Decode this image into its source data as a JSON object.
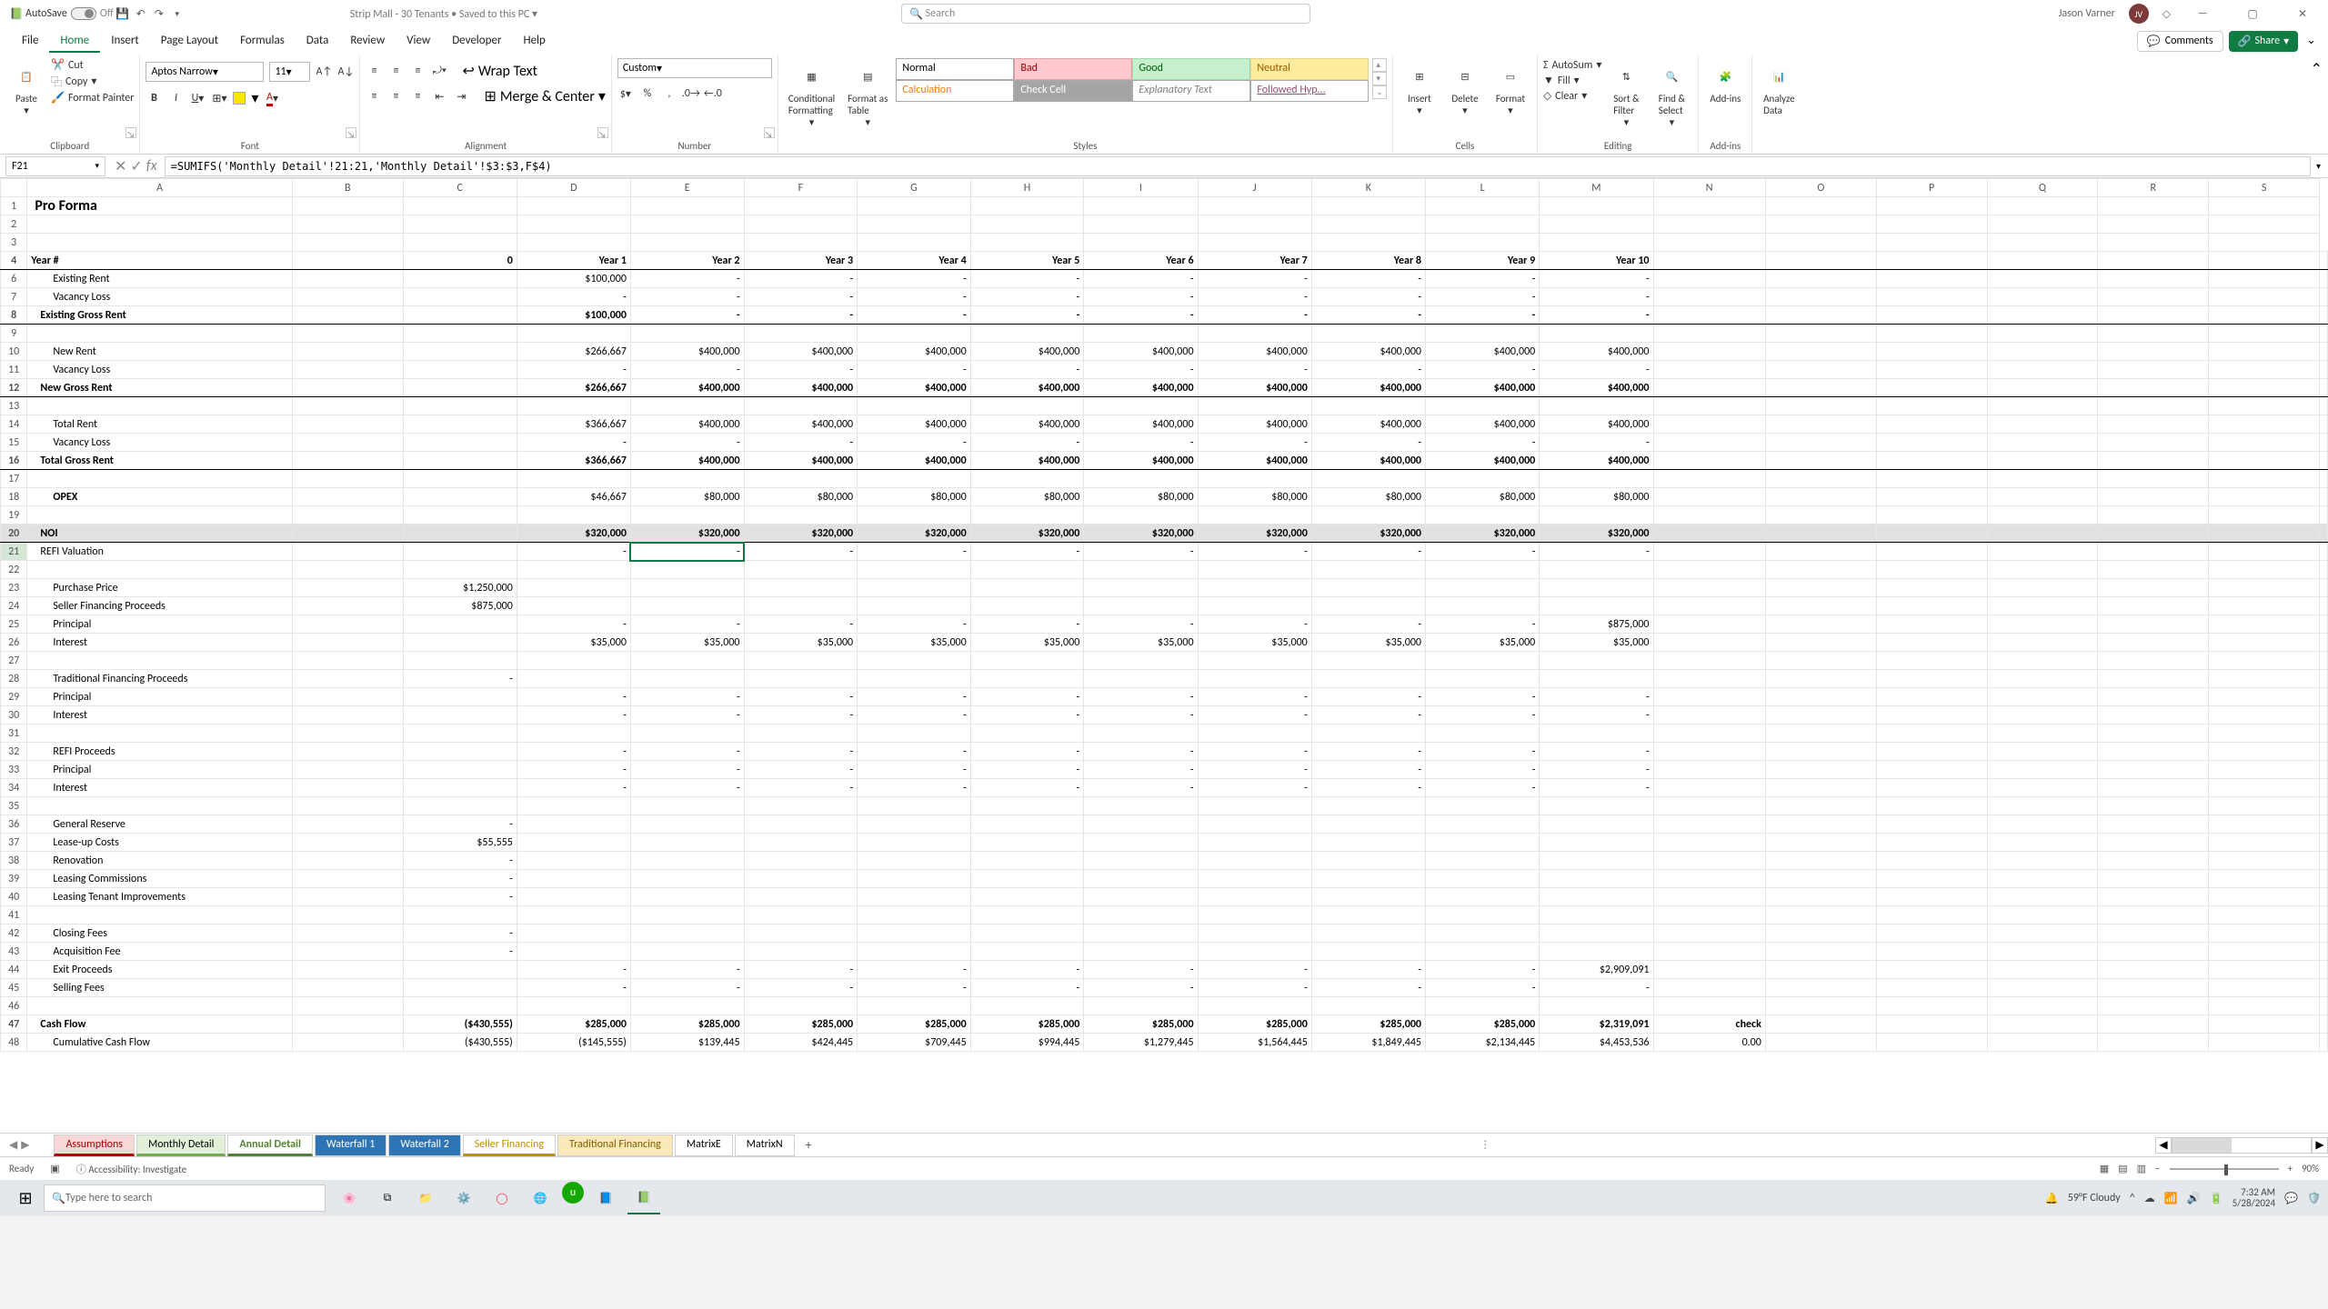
{
  "titleBar": {
    "autosave_label": "AutoSave",
    "autosave_state": "Off",
    "doc_name": "Strip Mall - 30 Tenants • Saved to this PC ▾",
    "search_placeholder": "Search",
    "user_name": "Jason Varner",
    "user_initials": "JV"
  },
  "menu": {
    "items": [
      "File",
      "Home",
      "Insert",
      "Page Layout",
      "Formulas",
      "Data",
      "Review",
      "View",
      "Developer",
      "Help"
    ],
    "active_index": 1,
    "comments": "Comments",
    "share": "Share"
  },
  "ribbon": {
    "clipboard": {
      "label": "Clipboard",
      "paste": "Paste",
      "cut": "Cut",
      "copy": "Copy",
      "painter": "Format Painter"
    },
    "font": {
      "label": "Font",
      "name": "Aptos Narrow",
      "size": "11"
    },
    "align": {
      "label": "Alignment",
      "wrap": "Wrap Text",
      "merge": "Merge & Center"
    },
    "number": {
      "label": "Number",
      "format": "Custom"
    },
    "styles": {
      "label": "Styles",
      "conditional": "Conditional\nFormatting",
      "table": "Format as\nTable",
      "normal": "Normal",
      "bad": "Bad",
      "good": "Good",
      "neutral": "Neutral",
      "calculation": "Calculation",
      "check": "Check Cell",
      "explan": "Explanatory Text",
      "followed": "Followed Hyp..."
    },
    "cells": {
      "label": "Cells",
      "insert": "Insert",
      "delete": "Delete",
      "format": "Format"
    },
    "editing": {
      "label": "Editing",
      "autosum": "AutoSum",
      "fill": "Fill",
      "clear": "Clear",
      "sort": "Sort &\nFilter",
      "find": "Find &\nSelect"
    },
    "addins": {
      "label": "Add-ins",
      "btn": "Add-ins"
    },
    "analyze": {
      "label": "",
      "btn": "Analyze\nData"
    }
  },
  "formula": {
    "cell_ref": "F21",
    "value": "=SUMIFS('Monthly Detail'!21:21,'Monthly Detail'!$3:$3,F$4)"
  },
  "chart_data": {
    "type": "table",
    "title": "Pro Forma",
    "columns": [
      "",
      "Year #",
      "0",
      "Year 1",
      "Year 2",
      "Year 3",
      "Year 4",
      "Year 5",
      "Year 6",
      "Year 7",
      "Year 8",
      "Year 9",
      "Year 10"
    ],
    "col_letters": [
      "A",
      "B",
      "C",
      "D",
      "E",
      "F",
      "G",
      "H",
      "I",
      "J",
      "K",
      "L",
      "M",
      "N",
      "O",
      "P",
      "Q",
      "R",
      "S"
    ],
    "rows": [
      {
        "n": 4,
        "label": "Year #",
        "style": "hdr",
        "vals": [
          "",
          "0",
          "Year 1",
          "Year 2",
          "Year 3",
          "Year 4",
          "Year 5",
          "Year 6",
          "Year 7",
          "Year 8",
          "Year 9",
          "Year 10"
        ]
      },
      {
        "n": 6,
        "label": "Existing Rent",
        "indent": true,
        "vals": [
          "",
          "",
          "$100,000",
          "-",
          "-",
          "-",
          "-",
          "-",
          "-",
          "-",
          "-",
          "-"
        ]
      },
      {
        "n": 7,
        "label": "Vacancy Loss",
        "indent": true,
        "vals": [
          "",
          "",
          "-",
          "-",
          "-",
          "-",
          "-",
          "-",
          "-",
          "-",
          "-",
          "-"
        ]
      },
      {
        "n": 8,
        "label": "Existing Gross Rent",
        "style": "existing-gr",
        "indent2": true,
        "vals": [
          "",
          "",
          "$100,000",
          "-",
          "-",
          "-",
          "-",
          "-",
          "-",
          "-",
          "-",
          "-"
        ]
      },
      {
        "n": 9,
        "label": "",
        "vals": [
          "",
          "",
          "",
          "",
          "",
          "",
          "",
          "",
          "",
          "",
          "",
          ""
        ]
      },
      {
        "n": 10,
        "label": "New Rent",
        "indent": true,
        "vals": [
          "",
          "",
          "$266,667",
          "$400,000",
          "$400,000",
          "$400,000",
          "$400,000",
          "$400,000",
          "$400,000",
          "$400,000",
          "$400,000",
          "$400,000"
        ]
      },
      {
        "n": 11,
        "label": "Vacancy Loss",
        "indent": true,
        "vals": [
          "",
          "",
          "-",
          "-",
          "-",
          "-",
          "-",
          "-",
          "-",
          "-",
          "-",
          "-"
        ]
      },
      {
        "n": 12,
        "label": "New Gross Rent",
        "style": "new-gr",
        "indent2": true,
        "vals": [
          "",
          "",
          "$266,667",
          "$400,000",
          "$400,000",
          "$400,000",
          "$400,000",
          "$400,000",
          "$400,000",
          "$400,000",
          "$400,000",
          "$400,000"
        ]
      },
      {
        "n": 13,
        "label": "",
        "vals": [
          "",
          "",
          "",
          "",
          "",
          "",
          "",
          "",
          "",
          "",
          "",
          ""
        ]
      },
      {
        "n": 14,
        "label": "Total Rent",
        "indent": true,
        "vals": [
          "",
          "",
          "$366,667",
          "$400,000",
          "$400,000",
          "$400,000",
          "$400,000",
          "$400,000",
          "$400,000",
          "$400,000",
          "$400,000",
          "$400,000"
        ]
      },
      {
        "n": 15,
        "label": "Vacancy Loss",
        "indent": true,
        "vals": [
          "",
          "",
          "-",
          "-",
          "-",
          "-",
          "-",
          "-",
          "-",
          "-",
          "-",
          "-"
        ]
      },
      {
        "n": 16,
        "label": "Total Gross Rent",
        "style": "tot-gr",
        "indent2": true,
        "vals": [
          "",
          "",
          "$366,667",
          "$400,000",
          "$400,000",
          "$400,000",
          "$400,000",
          "$400,000",
          "$400,000",
          "$400,000",
          "$400,000",
          "$400,000"
        ]
      },
      {
        "n": 17,
        "label": "",
        "vals": [
          "",
          "",
          "",
          "",
          "",
          "",
          "",
          "",
          "",
          "",
          "",
          ""
        ]
      },
      {
        "n": 18,
        "label": "OPEX",
        "indent": true,
        "bold": true,
        "vals": [
          "",
          "",
          "$46,667",
          "$80,000",
          "$80,000",
          "$80,000",
          "$80,000",
          "$80,000",
          "$80,000",
          "$80,000",
          "$80,000",
          "$80,000"
        ]
      },
      {
        "n": 19,
        "label": "",
        "vals": [
          "",
          "",
          "",
          "",
          "",
          "",
          "",
          "",
          "",
          "",
          "",
          ""
        ]
      },
      {
        "n": 20,
        "label": "NOI",
        "style": "noi",
        "indent2": true,
        "vals": [
          "",
          "",
          "$320,000",
          "$320,000",
          "$320,000",
          "$320,000",
          "$320,000",
          "$320,000",
          "$320,000",
          "$320,000",
          "$320,000",
          "$320,000"
        ]
      },
      {
        "n": 21,
        "label": "REFI Valuation",
        "indent2": true,
        "sel": true,
        "vals": [
          "",
          "",
          "-",
          "-",
          "-",
          "-",
          "-",
          "-",
          "-",
          "-",
          "-",
          "-"
        ]
      },
      {
        "n": 22,
        "label": "",
        "vals": [
          "",
          "",
          "",
          "",
          "",
          "",
          "",
          "",
          "",
          "",
          "",
          ""
        ]
      },
      {
        "n": 23,
        "label": "Purchase Price",
        "indent": true,
        "vals": [
          "",
          "$1,250,000",
          "",
          "",
          "",
          "",
          "",
          "",
          "",
          "",
          "",
          ""
        ]
      },
      {
        "n": 24,
        "label": "Seller Financing Proceeds",
        "indent": true,
        "vals": [
          "",
          "$875,000",
          "",
          "",
          "",
          "",
          "",
          "",
          "",
          "",
          "",
          ""
        ]
      },
      {
        "n": 25,
        "label": "Principal",
        "indent": true,
        "vals": [
          "",
          "",
          "-",
          "-",
          "-",
          "-",
          "-",
          "-",
          "-",
          "-",
          "-",
          "$875,000"
        ]
      },
      {
        "n": 26,
        "label": "Interest",
        "indent": true,
        "vals": [
          "",
          "",
          "$35,000",
          "$35,000",
          "$35,000",
          "$35,000",
          "$35,000",
          "$35,000",
          "$35,000",
          "$35,000",
          "$35,000",
          "$35,000"
        ]
      },
      {
        "n": 27,
        "label": "",
        "vals": [
          "",
          "",
          "",
          "",
          "",
          "",
          "",
          "",
          "",
          "",
          "",
          ""
        ]
      },
      {
        "n": 28,
        "label": "Traditional Financing Proceeds",
        "indent": true,
        "vals": [
          "",
          "-",
          "",
          "",
          "",
          "",
          "",
          "",
          "",
          "",
          "",
          ""
        ]
      },
      {
        "n": 29,
        "label": "Principal",
        "indent": true,
        "vals": [
          "",
          "",
          "-",
          "-",
          "-",
          "-",
          "-",
          "-",
          "-",
          "-",
          "-",
          "-"
        ]
      },
      {
        "n": 30,
        "label": "Interest",
        "indent": true,
        "vals": [
          "",
          "",
          "-",
          "-",
          "-",
          "-",
          "-",
          "-",
          "-",
          "-",
          "-",
          "-"
        ]
      },
      {
        "n": 31,
        "label": "",
        "vals": [
          "",
          "",
          "",
          "",
          "",
          "",
          "",
          "",
          "",
          "",
          "",
          ""
        ]
      },
      {
        "n": 32,
        "label": "REFI Proceeds",
        "indent": true,
        "vals": [
          "",
          "",
          "-",
          "-",
          "-",
          "-",
          "-",
          "-",
          "-",
          "-",
          "-",
          "-"
        ]
      },
      {
        "n": 33,
        "label": "Principal",
        "indent": true,
        "vals": [
          "",
          "",
          "-",
          "-",
          "-",
          "-",
          "-",
          "-",
          "-",
          "-",
          "-",
          "-"
        ]
      },
      {
        "n": 34,
        "label": "Interest",
        "indent": true,
        "vals": [
          "",
          "",
          "-",
          "-",
          "-",
          "-",
          "-",
          "-",
          "-",
          "-",
          "-",
          "-"
        ]
      },
      {
        "n": 35,
        "label": "",
        "vals": [
          "",
          "",
          "",
          "",
          "",
          "",
          "",
          "",
          "",
          "",
          "",
          ""
        ]
      },
      {
        "n": 36,
        "label": "General Reserve",
        "indent": true,
        "vals": [
          "",
          "-",
          "",
          "",
          "",
          "",
          "",
          "",
          "",
          "",
          "",
          ""
        ]
      },
      {
        "n": 37,
        "label": "Lease-up Costs",
        "indent": true,
        "vals": [
          "",
          "$55,555",
          "",
          "",
          "",
          "",
          "",
          "",
          "",
          "",
          "",
          ""
        ]
      },
      {
        "n": 38,
        "label": "Renovation",
        "indent": true,
        "vals": [
          "",
          "-",
          "",
          "",
          "",
          "",
          "",
          "",
          "",
          "",
          "",
          ""
        ]
      },
      {
        "n": 39,
        "label": "Leasing Commissions",
        "indent": true,
        "vals": [
          "",
          "-",
          "",
          "",
          "",
          "",
          "",
          "",
          "",
          "",
          "",
          ""
        ]
      },
      {
        "n": 40,
        "label": "Leasing Tenant Improvements",
        "indent": true,
        "vals": [
          "",
          "-",
          "",
          "",
          "",
          "",
          "",
          "",
          "",
          "",
          "",
          ""
        ]
      },
      {
        "n": 41,
        "label": "",
        "vals": [
          "",
          "",
          "",
          "",
          "",
          "",
          "",
          "",
          "",
          "",
          "",
          ""
        ]
      },
      {
        "n": 42,
        "label": "Closing Fees",
        "indent": true,
        "vals": [
          "",
          "-",
          "",
          "",
          "",
          "",
          "",
          "",
          "",
          "",
          "",
          ""
        ]
      },
      {
        "n": 43,
        "label": "Acquisition Fee",
        "indent": true,
        "vals": [
          "",
          "-",
          "",
          "",
          "",
          "",
          "",
          "",
          "",
          "",
          "",
          ""
        ]
      },
      {
        "n": 44,
        "label": "Exit Proceeds",
        "indent": true,
        "vals": [
          "",
          "",
          "-",
          "-",
          "-",
          "-",
          "-",
          "-",
          "-",
          "-",
          "-",
          "$2,909,091"
        ]
      },
      {
        "n": 45,
        "label": "Selling Fees",
        "indent": true,
        "vals": [
          "",
          "",
          "-",
          "-",
          "-",
          "-",
          "-",
          "-",
          "-",
          "-",
          "-",
          "-"
        ]
      },
      {
        "n": 46,
        "label": "",
        "vals": [
          "",
          "",
          "",
          "",
          "",
          "",
          "",
          "",
          "",
          "",
          "",
          ""
        ]
      },
      {
        "n": 47,
        "label": "Cash Flow",
        "style": "cf",
        "indent2": true,
        "vals": [
          "",
          "($430,555)",
          "$285,000",
          "$285,000",
          "$285,000",
          "$285,000",
          "$285,000",
          "$285,000",
          "$285,000",
          "$285,000",
          "$285,000",
          "$2,319,091"
        ],
        "extra": [
          "check"
        ]
      },
      {
        "n": 48,
        "label": "Cumulative Cash Flow",
        "indent": true,
        "vals": [
          "",
          "($430,555)",
          "($145,555)",
          "$139,445",
          "$424,445",
          "$709,445",
          "$994,445",
          "$1,279,445",
          "$1,564,445",
          "$1,849,445",
          "$2,134,445",
          "$4,453,536"
        ],
        "extra": [
          "0.00"
        ]
      }
    ]
  },
  "sheets": {
    "tabs": [
      {
        "name": "Assumptions",
        "cls": "red"
      },
      {
        "name": "Monthly Detail",
        "cls": "lime"
      },
      {
        "name": "Annual Detail",
        "cls": "active"
      },
      {
        "name": "Waterfall 1",
        "cls": "blue"
      },
      {
        "name": "Waterfall 2",
        "cls": "blue"
      },
      {
        "name": "Seller Financing",
        "cls": "gold"
      },
      {
        "name": "Traditional Financing",
        "cls": "gold2"
      },
      {
        "name": "MatrixE",
        "cls": "plain"
      },
      {
        "name": "MatrixN",
        "cls": "plain"
      }
    ]
  },
  "status": {
    "ready": "Ready",
    "accessibility": "Accessibility: Investigate",
    "zoom": "90%"
  },
  "taskbar": {
    "search_placeholder": "Type here to search",
    "weather": "59°F  Cloudy",
    "time": "7:32 AM",
    "date": "5/28/2024"
  }
}
